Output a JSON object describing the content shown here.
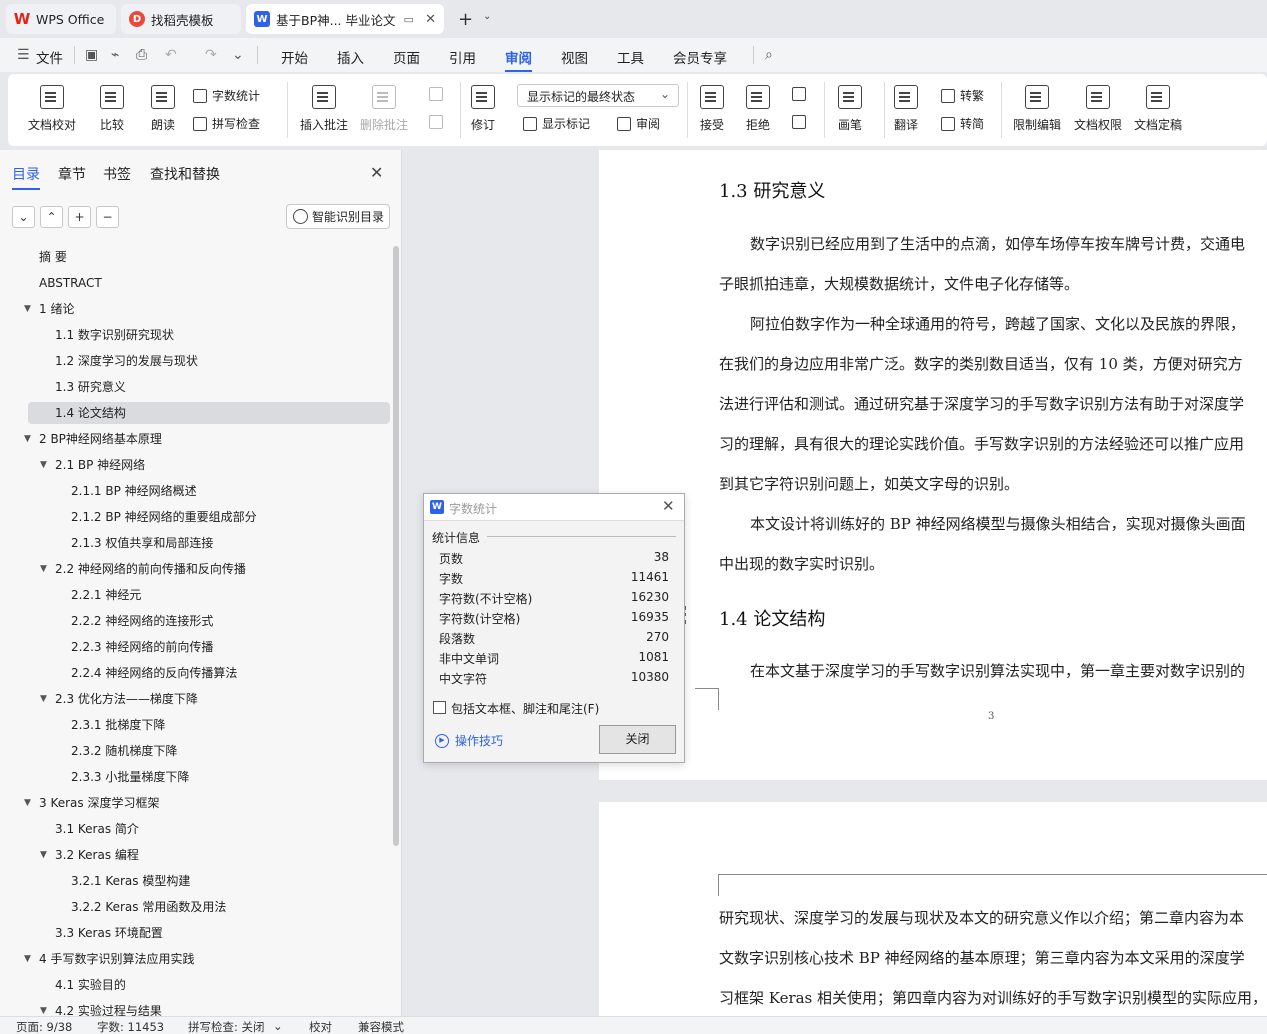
{
  "tabs": {
    "wps": "WPS Office",
    "daoke": "找稻壳模板",
    "doc": "基于BP神... 毕业论文"
  },
  "menu": {
    "file": "文件",
    "items": [
      "开始",
      "插入",
      "页面",
      "引用",
      "审阅",
      "视图",
      "工具",
      "会员专享"
    ],
    "active": "审阅"
  },
  "ribbon": {
    "doc_check": "文档校对",
    "compare": "比较",
    "read_aloud": "朗读",
    "word_count": "字数统计",
    "spell_check": "拼写检查",
    "insert_comment": "插入批注",
    "delete_comment": "删除批注",
    "revise": "修订",
    "markup_state": "显示标记的最终状态",
    "show_markup": "显示标记",
    "review": "审阅",
    "accept": "接受",
    "reject": "拒绝",
    "ink": "画笔",
    "translate": "翻译",
    "to_traditional": "转繁",
    "to_simplified": "转简",
    "restrict_edit": "限制编辑",
    "doc_permission": "文档权限",
    "doc_finalize": "文档定稿"
  },
  "sidebar": {
    "tabs": [
      "目录",
      "章节",
      "书签",
      "查找和替换"
    ],
    "smart_button": "智能识别目录",
    "toc": [
      {
        "label": "摘  要",
        "level": 0,
        "exp": false
      },
      {
        "label": "ABSTRACT",
        "level": 0,
        "exp": false
      },
      {
        "label": "1  绪论",
        "level": 0,
        "exp": true
      },
      {
        "label": "1.1  数字识别研究现状",
        "level": 1,
        "exp": false
      },
      {
        "label": "1.2  深度学习的发展与现状",
        "level": 1,
        "exp": false
      },
      {
        "label": "1.3  研究意义",
        "level": 1,
        "exp": false
      },
      {
        "label": "1.4  论文结构",
        "level": 1,
        "exp": false,
        "sel": true
      },
      {
        "label": "2 BP神经网络基本原理",
        "level": 0,
        "exp": true
      },
      {
        "label": "2.1 BP 神经网络",
        "level": 1,
        "exp": true
      },
      {
        "label": "2.1.1 BP 神经网络概述",
        "level": 2,
        "exp": false
      },
      {
        "label": "2.1.2 BP 神经网络的重要组成部分",
        "level": 2,
        "exp": false
      },
      {
        "label": "2.1.3  权值共享和局部连接",
        "level": 2,
        "exp": false
      },
      {
        "label": "2.2  神经网络的前向传播和反向传播",
        "level": 1,
        "exp": true
      },
      {
        "label": "2.2.1  神经元",
        "level": 2,
        "exp": false
      },
      {
        "label": "2.2.2  神经网络的连接形式",
        "level": 2,
        "exp": false
      },
      {
        "label": "2.2.3  神经网络的前向传播",
        "level": 2,
        "exp": false
      },
      {
        "label": "2.2.4  神经网络的反向传播算法",
        "level": 2,
        "exp": false
      },
      {
        "label": "2.3  优化方法——梯度下降",
        "level": 1,
        "exp": true
      },
      {
        "label": "2.3.1  批梯度下降",
        "level": 2,
        "exp": false
      },
      {
        "label": "2.3.2  随机梯度下降",
        "level": 2,
        "exp": false
      },
      {
        "label": "2.3.3  小批量梯度下降",
        "level": 2,
        "exp": false
      },
      {
        "label": "3 Keras 深度学习框架",
        "level": 0,
        "exp": true
      },
      {
        "label": "3.1 Keras 简介",
        "level": 1,
        "exp": false
      },
      {
        "label": "3.2 Keras 编程",
        "level": 1,
        "exp": true
      },
      {
        "label": "3.2.1 Keras 模型构建",
        "level": 2,
        "exp": false
      },
      {
        "label": "3.2.2 Keras 常用函数及用法",
        "level": 2,
        "exp": false
      },
      {
        "label": "3.3 Keras 环境配置",
        "level": 1,
        "exp": false
      },
      {
        "label": "4  手写数字识别算法应用实践",
        "level": 0,
        "exp": true
      },
      {
        "label": "4.1 实验目的",
        "level": 1,
        "exp": false
      },
      {
        "label": "4.2 实验过程与结果",
        "level": 1,
        "exp": true
      }
    ]
  },
  "document": {
    "h_13": "1.3  研究意义",
    "p1_l1": "数字识别已经应用到了生活中的点滴，如停车场停车按车牌号计费，交通电",
    "p1_l2": "子眼抓拍违章，大规模数据统计，文件电子化存储等。",
    "p2_l1": "阿拉伯数字作为一种全球通用的符号，跨越了国家、文化以及民族的界限，",
    "p2_l2": "在我们的身边应用非常广泛。数字的类别数目适当，仅有 10 类，方便对研究方",
    "p2_l3": "法进行评估和测试。通过研究基于深度学习的手写数字识别方法有助于对深度学",
    "p2_l4": "习的理解，具有很大的理论实践价值。手写数字识别的方法经验还可以推广应用",
    "p2_l5": "到其它字符识别问题上，如英文字母的识别。",
    "p3_l1": "本文设计将训练好的 BP 神经网络模型与摄像头相结合，实现对摄像头画面",
    "p3_l2": "中出现的数字实时识别。",
    "h_14": "1.4  论文结构",
    "p4_l1": "在本文基于深度学习的手写数字识别算法实现中，第一章主要对数字识别的",
    "page_number": "3",
    "p5_l1": "研究现状、深度学习的发展与现状及本文的研究意义作以介绍；第二章内容为本",
    "p5_l2": "文数字识别核心技术 BP 神经网络的基本原理；第三章内容为本文采用的深度学",
    "p5_l3": "习框架 Keras 相关使用；第四章内容为对训练好的手写数字识别模型的实际应用，"
  },
  "dialog": {
    "title": "字数统计",
    "section": "统计信息",
    "rows": [
      {
        "label": "页数",
        "value": "38"
      },
      {
        "label": "字数",
        "value": "11461"
      },
      {
        "label": "字符数(不计空格)",
        "value": "16230"
      },
      {
        "label": "字符数(计空格)",
        "value": "16935"
      },
      {
        "label": "段落数",
        "value": "270"
      },
      {
        "label": "非中文单词",
        "value": "1081"
      },
      {
        "label": "中文字符",
        "value": "10380"
      }
    ],
    "checkbox_label": "包括文本框、脚注和尾注(F)",
    "tips": "操作技巧",
    "close": "关闭"
  },
  "status": {
    "page": "页面: 9/38",
    "words": "字数: 11453",
    "spell": "拼写检查: 关闭",
    "proof": "校对",
    "compat": "兼容模式"
  }
}
